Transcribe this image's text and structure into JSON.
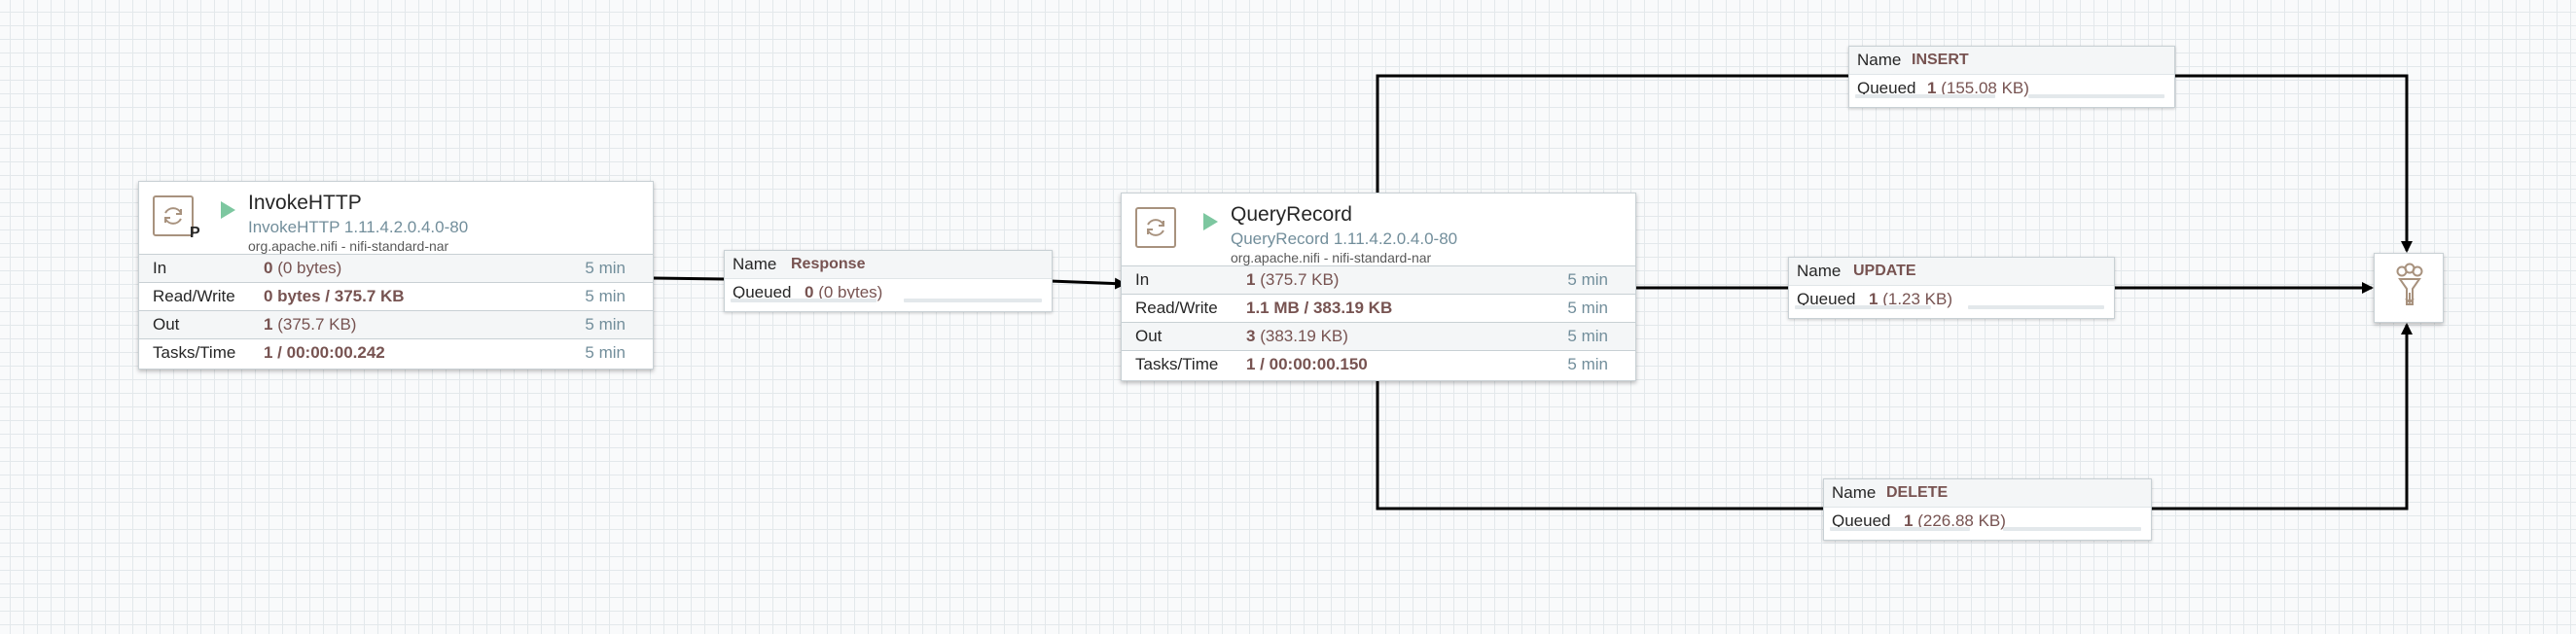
{
  "processors": [
    {
      "name": "InvokeHTTP",
      "type": "InvokeHTTP 1.11.4.2.0.4.0-80",
      "bundle": "org.apache.nifi - nifi-standard-nar",
      "primary_badge": "P",
      "stats": {
        "in": {
          "label": "In",
          "count": "0",
          "size": "(0 bytes)",
          "tf": "5 min"
        },
        "rw": {
          "label": "Read/Write",
          "value": "0 bytes / 375.7 KB",
          "tf": "5 min"
        },
        "out": {
          "label": "Out",
          "count": "1",
          "size": "(375.7 KB)",
          "tf": "5 min"
        },
        "tasks": {
          "label": "Tasks/Time",
          "value": "1 / 00:00:00.242",
          "tf": "5 min"
        }
      }
    },
    {
      "name": "QueryRecord",
      "type": "QueryRecord 1.11.4.2.0.4.0-80",
      "bundle": "org.apache.nifi - nifi-standard-nar",
      "stats": {
        "in": {
          "label": "In",
          "count": "1",
          "size": "(375.7 KB)",
          "tf": "5 min"
        },
        "rw": {
          "label": "Read/Write",
          "value": "1.1 MB / 383.19 KB",
          "tf": "5 min"
        },
        "out": {
          "label": "Out",
          "count": "3",
          "size": "(383.19 KB)",
          "tf": "5 min"
        },
        "tasks": {
          "label": "Tasks/Time",
          "value": "1 / 00:00:00.150",
          "tf": "5 min"
        }
      }
    }
  ],
  "connections": {
    "response": {
      "name_key": "Name",
      "name": "Response",
      "queued_key": "Queued",
      "count": "0",
      "size": "(0 bytes)"
    },
    "insert": {
      "name_key": "Name",
      "name": "INSERT",
      "queued_key": "Queued",
      "count": "1",
      "size": "(155.08 KB)"
    },
    "update": {
      "name_key": "Name",
      "name": "UPDATE",
      "queued_key": "Queued",
      "count": "1",
      "size": "(1.23 KB)"
    },
    "delete": {
      "name_key": "Name",
      "name": "DELETE",
      "queued_key": "Queued",
      "count": "1",
      "size": "(226.88 KB)"
    }
  },
  "icons": {
    "processor": "processor-icon",
    "run": "run-state-icon",
    "funnel": "funnel-icon"
  },
  "colors": {
    "value_text": "#775351",
    "type_text": "#728e9b",
    "run_state": "#7dc7a0",
    "connection_line": "#000000"
  }
}
